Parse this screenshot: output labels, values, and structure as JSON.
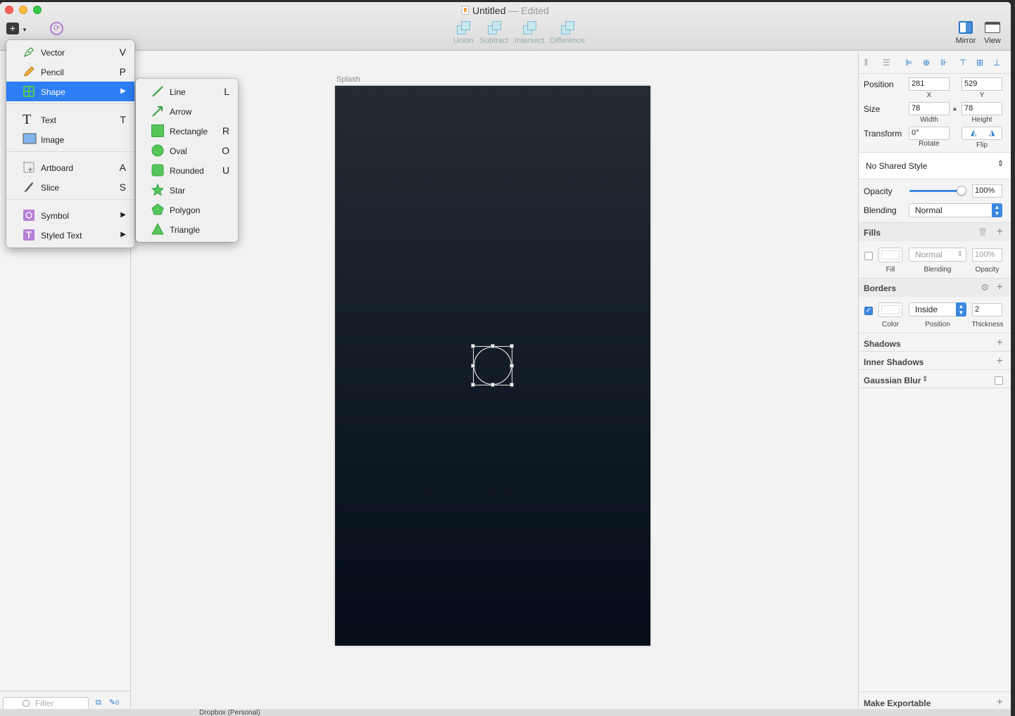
{
  "window": {
    "title": "Untitled",
    "edited": "— Edited"
  },
  "toolbar": {
    "boolean_ops": [
      "Union",
      "Subtract",
      "Intersect",
      "Difference"
    ],
    "mirror_label": "Mirror",
    "view_label": "View"
  },
  "insert_menu": {
    "items": [
      {
        "label": "Vector",
        "key": "V"
      },
      {
        "label": "Pencil",
        "key": "P"
      },
      {
        "label": "Shape",
        "key": ""
      },
      {
        "label": "Text",
        "key": "T"
      },
      {
        "label": "Image",
        "key": ""
      },
      {
        "label": "Artboard",
        "key": "A"
      },
      {
        "label": "Slice",
        "key": "S"
      },
      {
        "label": "Symbol",
        "key": ""
      },
      {
        "label": "Styled Text",
        "key": ""
      }
    ],
    "active": "Shape"
  },
  "shape_submenu": {
    "items": [
      {
        "label": "Line",
        "key": "L"
      },
      {
        "label": "Arrow",
        "key": ""
      },
      {
        "label": "Rectangle",
        "key": "R"
      },
      {
        "label": "Oval",
        "key": "O"
      },
      {
        "label": "Rounded",
        "key": "U"
      },
      {
        "label": "Star",
        "key": ""
      },
      {
        "label": "Polygon",
        "key": ""
      },
      {
        "label": "Triangle",
        "key": ""
      }
    ]
  },
  "layers": {
    "filter_placeholder": "Filter",
    "slice_count": "0"
  },
  "canvas": {
    "artboard_name": "Splash"
  },
  "inspector": {
    "position_label": "Position",
    "x": "281",
    "y": "529",
    "x_label": "X",
    "y_label": "Y",
    "size_label": "Size",
    "width": "78",
    "height": "78",
    "width_label": "Width",
    "height_label": "Height",
    "transform_label": "Transform",
    "rotate": "0°",
    "rotate_label": "Rotate",
    "flip_label": "Flip",
    "shared_style": "No Shared Style",
    "opacity_label": "Opacity",
    "opacity": "100%",
    "opacity_fraction": 1.0,
    "blending_label": "Blending",
    "blending": "Normal",
    "fills": {
      "title": "Fills",
      "blending": "Normal",
      "opacity": "100%",
      "fill_label": "Fill",
      "blending_label": "Blending",
      "opacity_label": "Opacity",
      "enabled": false
    },
    "borders": {
      "title": "Borders",
      "position": "Inside",
      "thickness": "2",
      "color_label": "Color",
      "position_label": "Position",
      "thickness_label": "Thickness",
      "enabled": true
    },
    "shadows_title": "Shadows",
    "inner_shadows_title": "Inner Shadows",
    "gaussian_blur_title": "Gaussian Blur",
    "make_exportable": "Make Exportable"
  },
  "colors": {
    "accent": "#2d7df6",
    "shape_green": "#54c65a",
    "artboard_top": "#242c33",
    "artboard_bottom": "#050d1a"
  },
  "bottom_strip": {
    "text": "Dropbox (Personal)"
  }
}
